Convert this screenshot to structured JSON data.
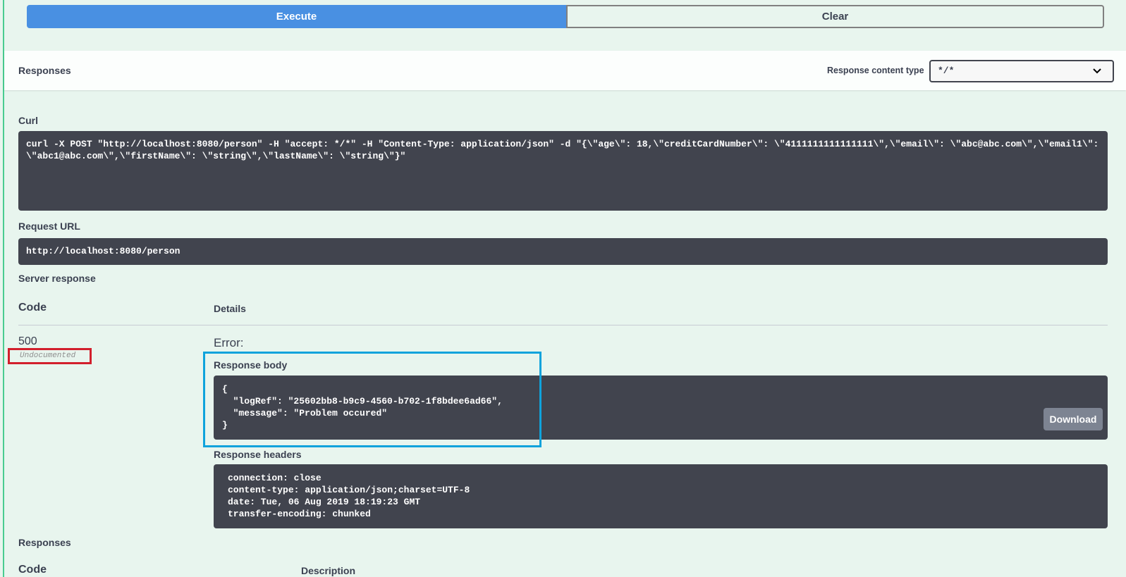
{
  "actions": {
    "execute_label": "Execute",
    "clear_label": "Clear"
  },
  "responses_header": {
    "title": "Responses",
    "content_type_label": "Response content type",
    "content_type_value": "*/*"
  },
  "curl": {
    "label": "Curl",
    "command": "curl -X POST \"http://localhost:8080/person\" -H \"accept: */*\" -H \"Content-Type: application/json\" -d \"{\\\"age\\\": 18,\\\"creditCardNumber\\\": \\\"4111111111111111\\\",\\\"email\\\": \\\"abc@abc.com\\\",\\\"email1\\\": \\\"abc1@abc.com\\\",\\\"firstName\\\": \\\"string\\\",\\\"lastName\\\": \\\"string\\\"}\""
  },
  "request_url": {
    "label": "Request URL",
    "value": "http://localhost:8080/person"
  },
  "server_response": {
    "label": "Server response",
    "code_header": "Code",
    "details_header": "Details",
    "code": "500",
    "code_note": "Undocumented",
    "error_label": "Error:",
    "body_label": "Response body",
    "body": "{\n  \"logRef\": \"25602bb8-b9c9-4560-b702-1f8bdee6ad66\",\n  \"message\": \"Problem occured\"\n}",
    "download_label": "Download",
    "headers_label": "Response headers",
    "headers": "connection: close\ncontent-type: application/json;charset=UTF-8\ndate: Tue, 06 Aug 2019 18:19:23 GMT\ntransfer-encoding: chunked"
  },
  "responses_section": {
    "label": "Responses",
    "code_header": "Code",
    "description_header": "Description"
  },
  "colors": {
    "execute_blue": "#4990e2",
    "code_bg": "#41444e",
    "highlight_red": "#d21f2c",
    "highlight_blue": "#0fa3dc",
    "page_bg": "#e8f5ee"
  },
  "icons": {
    "select_chevron": "chevron-down-icon"
  }
}
